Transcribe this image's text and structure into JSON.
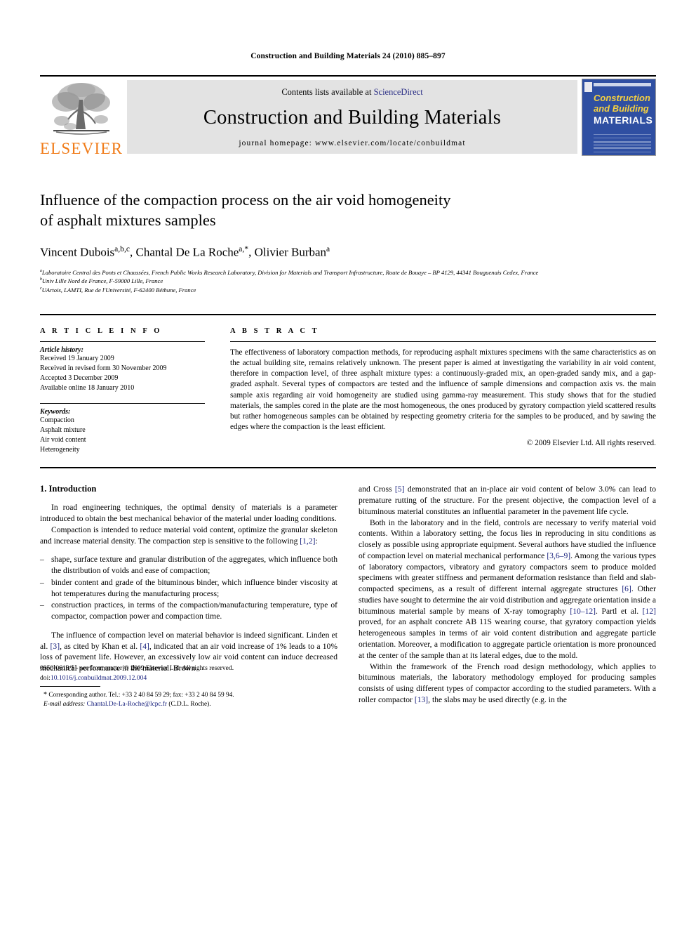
{
  "running_head": "Construction and Building Materials 24 (2010) 885–897",
  "masthead": {
    "publisher_name": "ELSEVIER",
    "contents_prefix": "Contents lists available at ",
    "contents_link": "ScienceDirect",
    "journal_title": "Construction and Building Materials",
    "homepage": "journal homepage: www.elsevier.com/locate/conbuildmat",
    "cover": {
      "line1": "Construction",
      "line2": "and Building",
      "line3": "MATERIALS"
    }
  },
  "article": {
    "title_line1": "Influence of the compaction process on the air void homogeneity",
    "title_line2": "of asphalt mixtures samples",
    "authors_plain": "Vincent Dubois a,b,c, Chantal De La Roche a,*, Olivier Burban a",
    "authors": [
      {
        "name": "Vincent Dubois",
        "marks": "a,b,c"
      },
      {
        "name": "Chantal De La Roche",
        "marks": "a,*"
      },
      {
        "name": "Olivier Burban",
        "marks": "a"
      }
    ],
    "affiliations": [
      {
        "mark": "a",
        "text": "Laboratoire Central des Ponts et Chaussées, French Public Works Research Laboratory, Division for Materials and Transport Infrastructure, Route de Bouaye – BP 4129, 44341 Bouguenais Cedex, France"
      },
      {
        "mark": "b",
        "text": "Univ Lille Nord de France, F-59000 Lille, France"
      },
      {
        "mark": "c",
        "text": "UArtois, LAMTI, Rue de l'Université, F-62400 Béthune, France"
      }
    ]
  },
  "info": {
    "label": "A R T I C L E    I N F O",
    "history_head": "Article history:",
    "history": [
      "Received 19 January 2009",
      "Received in revised form 30 November 2009",
      "Accepted 3 December 2009",
      "Available online 18 January 2010"
    ],
    "keywords_head": "Keywords:",
    "keywords": [
      "Compaction",
      "Asphalt mixture",
      "Air void content",
      "Heterogeneity"
    ]
  },
  "abstract": {
    "label": "A B S T R A C T",
    "text": "The effectiveness of laboratory compaction methods, for reproducing asphalt mixtures specimens with the same characteristics as on the actual building site, remains relatively unknown. The present paper is aimed at investigating the variability in air void content, therefore in compaction level, of three asphalt mixture types: a continuously-graded mix, an open-graded sandy mix, and a gap-graded asphalt. Several types of compactors are tested and the influence of sample dimensions and compaction axis vs. the main sample axis regarding air void homogeneity are studied using gamma-ray measurement. This study shows that for the studied materials, the samples cored in the plate are the most homogeneous, the ones produced by gyratory compaction yield scattered results but rather homogeneous samples can be obtained by respecting geometry criteria for the samples to be produced, and by sawing the edges where the compaction is the least efficient.",
    "copyright": "© 2009 Elsevier Ltd. All rights reserved."
  },
  "introduction": {
    "heading": "1. Introduction",
    "left": {
      "p1": "In road engineering techniques, the optimal density of materials is a parameter introduced to obtain the best mechanical behavior of the material under loading conditions.",
      "p2_a": "Compaction is intended to reduce material void content, optimize the granular skeleton and increase material density. The compaction step is sensitive to the following ",
      "p2_ref": "[1,2]",
      "p2_b": ":",
      "bullets": [
        "shape, surface texture and granular distribution of the aggregates, which influence both the distribution of voids and ease of compaction;",
        "binder content and grade of the bituminous binder, which influence binder viscosity at hot temperatures during the manufacturing process;",
        "construction practices, in terms of the compaction/manufacturing temperature, type of compactor, compaction power and compaction time."
      ],
      "p3_a": "The influence of compaction level on material behavior is indeed significant. Linden et al. ",
      "p3_ref1": "[3]",
      "p3_b": ", as cited by Khan et al. ",
      "p3_ref2": "[4]",
      "p3_c": ", indicated that an air void increase of 1% leads to a 10% loss of pavement life. However, an excessively low air void content can induce decreased mechanical performance in the material. Brown"
    },
    "right": {
      "p1_a": "and Cross ",
      "p1_ref": "[5]",
      "p1_b": " demonstrated that an in-place air void content of below 3.0% can lead to premature rutting of the structure. For the present objective, the compaction level of a bituminous material constitutes an influential parameter in the pavement life cycle.",
      "p2_a": "Both in the laboratory and in the field, controls are necessary to verify material void contents. Within a laboratory setting, the focus lies in reproducing in situ conditions as closely as possible using appropriate equipment. Several authors have studied the influence of compaction level on material mechanical performance ",
      "p2_ref1": "[3,6–9]",
      "p2_b": ". Among the various types of laboratory compactors, vibratory and gyratory compactors seem to produce molded specimens with greater stiffness and permanent deformation resistance than field and slab-compacted specimens, as a result of different internal aggregate structures ",
      "p2_ref2": "[6]",
      "p2_c": ". Other studies have sought to determine the air void distribution and aggregate orientation inside a bituminous material sample by means of X-ray tomography ",
      "p2_ref3": "[10–12]",
      "p2_d": ". Partl et al. ",
      "p2_ref4": "[12]",
      "p2_e": " proved, for an asphalt concrete AB 11S wearing course, that gyratory compaction yields heterogeneous samples in terms of air void content distribution and aggregate particle orientation. Moreover, a modification to aggregate particle orientation is more pronounced at the center of the sample than at its lateral edges, due to the mold.",
      "p3_a": "Within the framework of the French road design methodology, which applies to bituminous materials, the laboratory methodology employed for producing samples consists of using different types of compactor according to the studied parameters. With a roller compactor ",
      "p3_ref": "[13]",
      "p3_b": ", the slabs may be used directly (e.g. in the"
    }
  },
  "footnote": {
    "marker": "*",
    "line1": "Corresponding author. Tel.: +33 2 40 84 59 29; fax: +33 2 40 84 59 94.",
    "email_label": "E-mail address:",
    "email": "Chantal.De-La-Roche@lcpc.fr",
    "email_suffix": "(C.D.L. Roche)."
  },
  "page_footer": {
    "issn_line": "0950-0618/$ - see front matter © 2009 Elsevier Ltd. All rights reserved.",
    "doi_prefix": "doi:",
    "doi": "10.1016/j.conbuildmat.2009.12.004"
  },
  "colors": {
    "elsevier_orange": "#f07c1a",
    "link_navy": "#1a237e",
    "banner_gray": "#e3e3e3",
    "cover_blue": "#2f4fa2"
  }
}
